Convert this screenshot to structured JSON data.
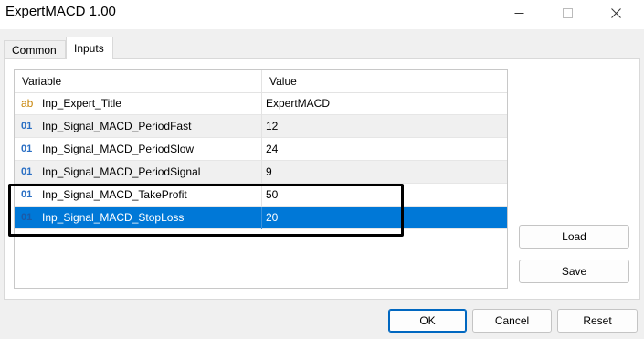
{
  "window": {
    "title": "ExpertMACD 1.00"
  },
  "tabs": [
    {
      "label": "Common",
      "active": false
    },
    {
      "label": "Inputs",
      "active": true
    }
  ],
  "table": {
    "headers": {
      "variable": "Variable",
      "value": "Value"
    },
    "rows": [
      {
        "icon": "ab",
        "icon_name": "string-type-icon",
        "name": "Inp_Expert_Title",
        "value": "ExpertMACD"
      },
      {
        "icon": "01",
        "icon_name": "integer-type-icon",
        "name": "Inp_Signal_MACD_PeriodFast",
        "value": "12"
      },
      {
        "icon": "01",
        "icon_name": "integer-type-icon",
        "name": "Inp_Signal_MACD_PeriodSlow",
        "value": "24"
      },
      {
        "icon": "01",
        "icon_name": "integer-type-icon",
        "name": "Inp_Signal_MACD_PeriodSignal",
        "value": "9"
      },
      {
        "icon": "01",
        "icon_name": "integer-type-icon",
        "name": "Inp_Signal_MACD_TakeProfit",
        "value": "50"
      },
      {
        "icon": "01",
        "icon_name": "integer-type-icon",
        "name": "Inp_Signal_MACD_StopLoss",
        "value": "20",
        "selected": true
      }
    ]
  },
  "side_buttons": {
    "load": "Load",
    "save": "Save"
  },
  "footer_buttons": {
    "ok": "OK",
    "cancel": "Cancel",
    "reset": "Reset"
  },
  "colors": {
    "selection": "#0078d7",
    "alt_row": "#f0f0f0",
    "highlight_box": "#000000"
  }
}
